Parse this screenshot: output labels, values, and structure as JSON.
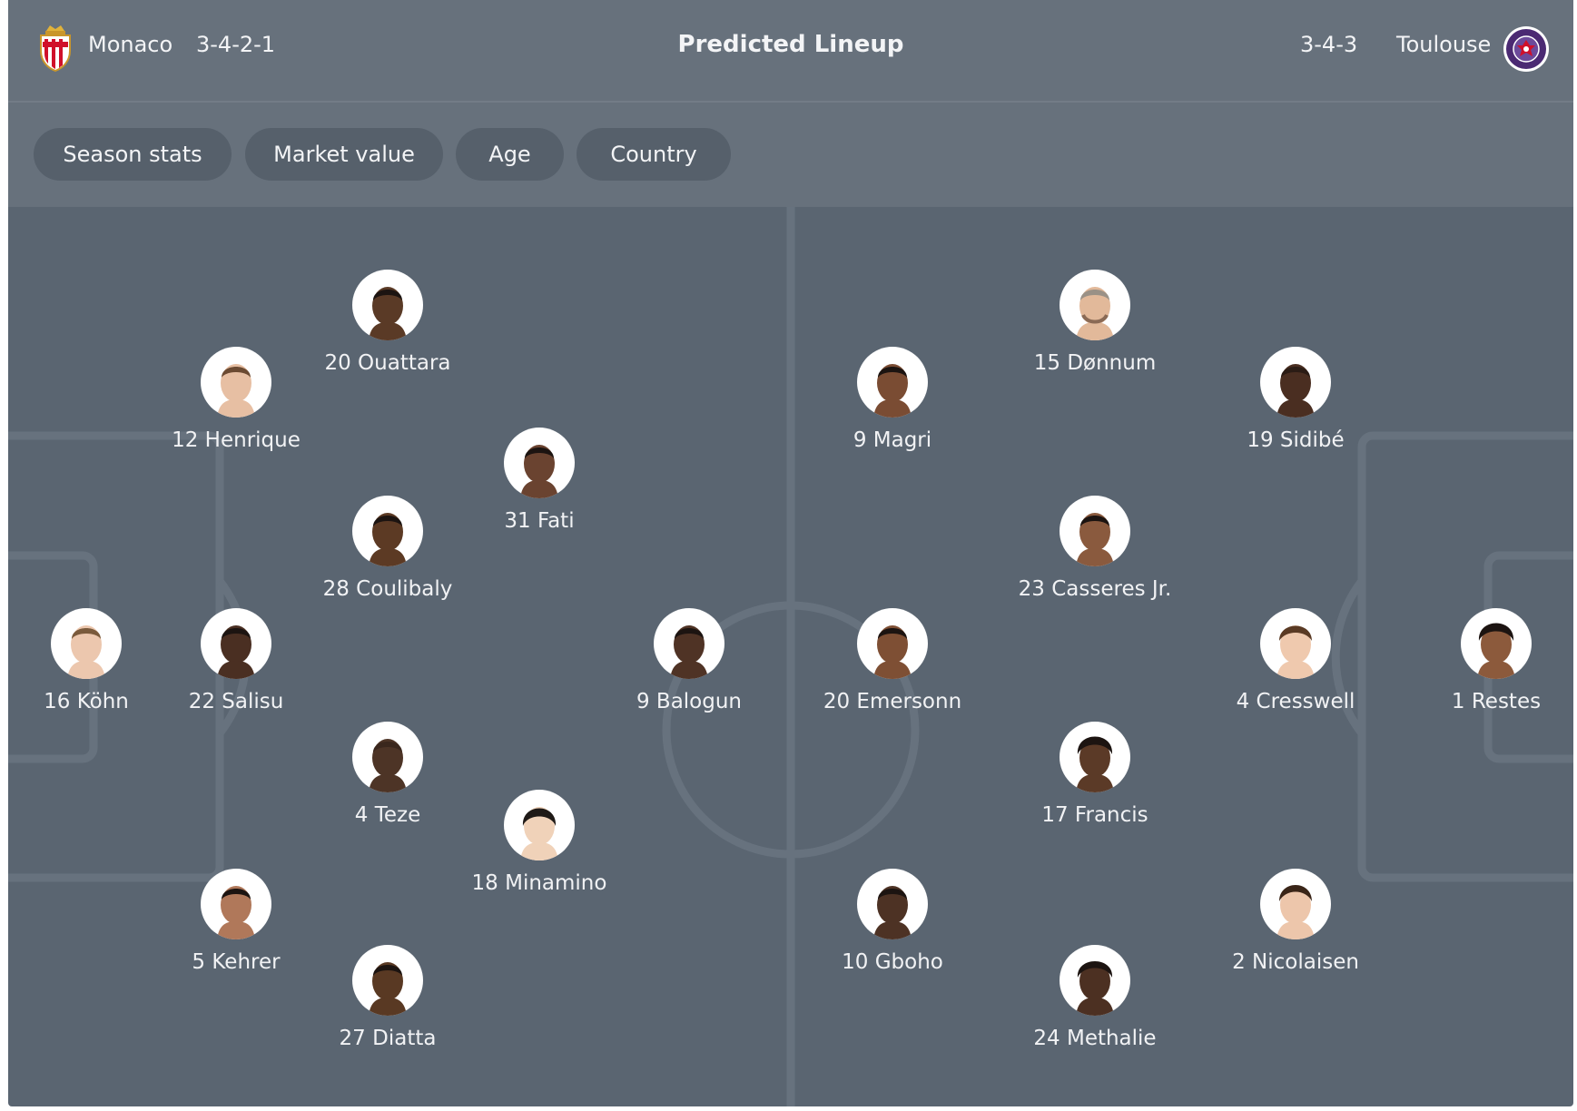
{
  "header": {
    "home_team": "Monaco",
    "home_formation": "3-4-2-1",
    "title": "Predicted Lineup",
    "away_formation": "3-4-3",
    "away_team": "Toulouse"
  },
  "filters": [
    {
      "label": "Season stats"
    },
    {
      "label": "Market value"
    },
    {
      "label": "Age"
    },
    {
      "label": "Country"
    }
  ],
  "colors": {
    "panel": "#67717c",
    "pitch": "#5a6571",
    "pitch_lines": "#67727e",
    "chip": "#56606b",
    "text": "#f3f4f6",
    "monaco_red": "#d0102a",
    "toulouse_purple": "#4b2a73"
  },
  "home_players": [
    {
      "label": "20 Ouattara",
      "skin": "#5a3a26"
    },
    {
      "label": "12 Henrique",
      "skin": "#e7bfa3"
    },
    {
      "label": "31 Fati",
      "skin": "#6a4330"
    },
    {
      "label": "28 Coulibaly",
      "skin": "#5c3a24"
    },
    {
      "label": "16 Köhn",
      "skin": "#ecc7ae"
    },
    {
      "label": "22 Salisu",
      "skin": "#4a2f22"
    },
    {
      "label": "9 Balogun",
      "skin": "#4f3325"
    },
    {
      "label": "4 Teze",
      "skin": "#4d3426"
    },
    {
      "label": "18 Minamino",
      "skin": "#f0d2b9"
    },
    {
      "label": "5 Kehrer",
      "skin": "#b0785a"
    },
    {
      "label": "27 Diatta",
      "skin": "#593923"
    }
  ],
  "away_players": [
    {
      "label": "15 Dønnum",
      "skin": "#e2b99a"
    },
    {
      "label": "9 Magri",
      "skin": "#7a4c33"
    },
    {
      "label": "19 Sidibé",
      "skin": "#4a2e21"
    },
    {
      "label": "23 Casseres Jr.",
      "skin": "#8a5a3e"
    },
    {
      "label": "20 Emersonn",
      "skin": "#7e4f34"
    },
    {
      "label": "4 Cresswell",
      "skin": "#efc9ae"
    },
    {
      "label": "1 Restes",
      "skin": "#8c5a3c"
    },
    {
      "label": "17 Francis",
      "skin": "#5b3a27"
    },
    {
      "label": "10 Gboho",
      "skin": "#4d3224"
    },
    {
      "label": "2 Nicolaisen",
      "skin": "#edc6ab"
    },
    {
      "label": "24 Methalie",
      "skin": "#4c3022"
    }
  ]
}
